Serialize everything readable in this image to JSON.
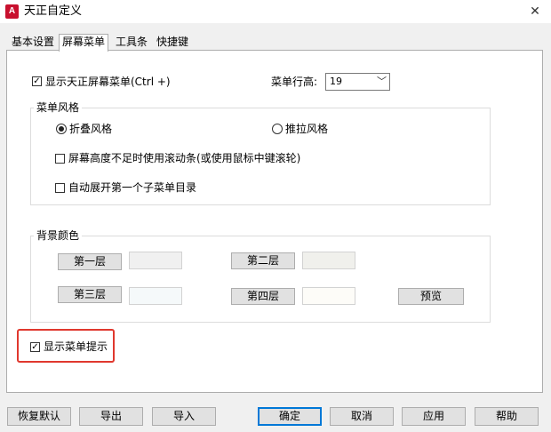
{
  "window": {
    "title": "天正自定义",
    "app_icon_text": "A",
    "close_glyph": "✕"
  },
  "tabs": [
    {
      "label": "基本设置",
      "active": false
    },
    {
      "label": "屏幕菜单",
      "active": true
    },
    {
      "label": "工具条",
      "active": false
    },
    {
      "label": "快捷键",
      "active": false
    }
  ],
  "screen_menu": {
    "show_menu": {
      "label": "显示天正屏幕菜单(Ctrl +)",
      "checked": true
    },
    "row_height": {
      "label": "菜单行高:",
      "value": "19"
    }
  },
  "menu_style": {
    "title": "菜单风格",
    "fold": {
      "label": "折叠风格",
      "selected": true
    },
    "pull": {
      "label": "推拉风格",
      "selected": false
    },
    "scrollbar": {
      "label": "屏幕高度不足时使用滚动条(或使用鼠标中键滚轮)",
      "checked": false
    },
    "auto_expand": {
      "label": "自动展开第一个子菜单目录",
      "checked": false
    }
  },
  "background_color": {
    "title": "背景颜色",
    "layers": [
      {
        "label": "第一层",
        "color": "#f0f0f0"
      },
      {
        "label": "第二层",
        "color": "#f0f0ec"
      },
      {
        "label": "第三层",
        "color": "#f5f9fa"
      },
      {
        "label": "第四层",
        "color": "#fdfcf8"
      }
    ],
    "preview_label": "预览"
  },
  "menu_tips": {
    "label": "显示菜单提示",
    "checked": true
  },
  "buttons": {
    "restore": "恢复默认",
    "export": "导出",
    "import": "导入",
    "ok": "确定",
    "cancel": "取消",
    "apply": "应用",
    "help": "帮助"
  },
  "colors": {
    "highlight": "#e0382e",
    "accent": "#0078d7",
    "icon": "#c8102e"
  }
}
